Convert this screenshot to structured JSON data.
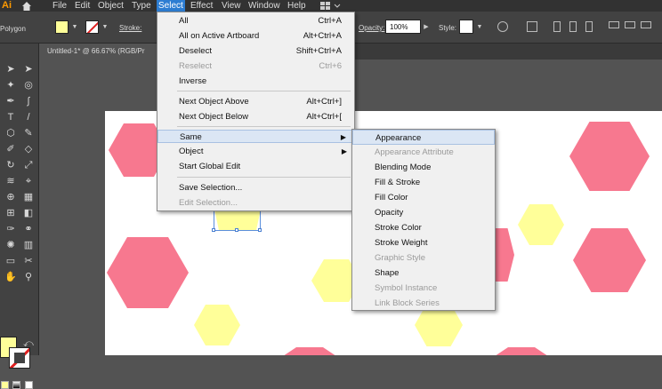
{
  "app": {
    "logo": "Ai"
  },
  "menubar": {
    "items": [
      "File",
      "Edit",
      "Object",
      "Type",
      "Select",
      "Effect",
      "View",
      "Window",
      "Help"
    ],
    "active": "Select"
  },
  "controlbar": {
    "tool_name": "Polygon",
    "stroke_label": "Stroke:",
    "opacity_label": "Opacity:",
    "opacity_value": "100%",
    "style_label": "Style:",
    "fill_color": "#ffff99"
  },
  "document_tab": {
    "title": "Untitled-1* @ 66.67% (RGB/Pr"
  },
  "select_menu": {
    "items": [
      {
        "label": "All",
        "shortcut": "Ctrl+A",
        "disabled": false
      },
      {
        "label": "All on Active Artboard",
        "shortcut": "Alt+Ctrl+A",
        "disabled": false
      },
      {
        "label": "Deselect",
        "shortcut": "Shift+Ctrl+A",
        "disabled": false
      },
      {
        "label": "Reselect",
        "shortcut": "Ctrl+6",
        "disabled": true
      },
      {
        "label": "Inverse",
        "shortcut": "",
        "disabled": false
      },
      {
        "label": "Next Object Above",
        "shortcut": "Alt+Ctrl+]",
        "disabled": false
      },
      {
        "label": "Next Object Below",
        "shortcut": "Alt+Ctrl+[",
        "disabled": false
      },
      {
        "label": "Same",
        "shortcut": "",
        "disabled": false,
        "submenu": true,
        "highlighted": true
      },
      {
        "label": "Object",
        "shortcut": "",
        "disabled": false,
        "submenu": true
      },
      {
        "label": "Start Global Edit",
        "shortcut": "",
        "disabled": false
      },
      {
        "label": "Save Selection...",
        "shortcut": "",
        "disabled": false
      },
      {
        "label": "Edit Selection...",
        "shortcut": "",
        "disabled": true
      }
    ]
  },
  "same_submenu": {
    "items": [
      {
        "label": "Appearance",
        "disabled": false,
        "highlighted": true
      },
      {
        "label": "Appearance Attribute",
        "disabled": true
      },
      {
        "label": "Blending Mode",
        "disabled": false
      },
      {
        "label": "Fill & Stroke",
        "disabled": false
      },
      {
        "label": "Fill Color",
        "disabled": false
      },
      {
        "label": "Opacity",
        "disabled": false
      },
      {
        "label": "Stroke Color",
        "disabled": false
      },
      {
        "label": "Stroke Weight",
        "disabled": false
      },
      {
        "label": "Graphic Style",
        "disabled": true
      },
      {
        "label": "Shape",
        "disabled": false
      },
      {
        "label": "Symbol Instance",
        "disabled": true
      },
      {
        "label": "Link Block Series",
        "disabled": true
      }
    ]
  },
  "colors": {
    "pink": "#f7788f",
    "yellow": "#ffff99",
    "menu_highlight": "#dbe6f4",
    "menubar_active": "#2d7dd2"
  }
}
